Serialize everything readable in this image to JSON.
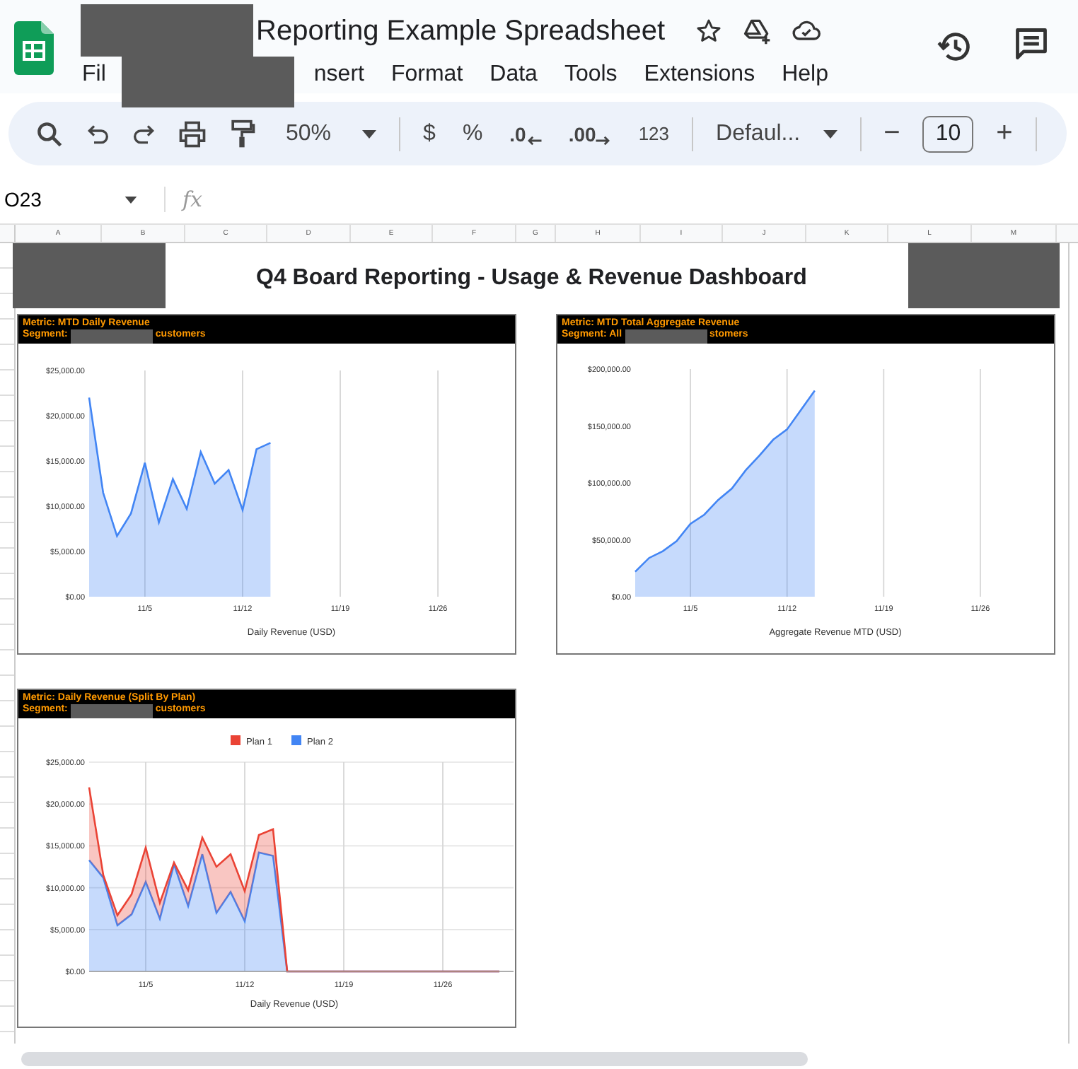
{
  "document": {
    "title": "Reporting Example Spreadsheet"
  },
  "menu": [
    "Fil",
    "nsert",
    "Format",
    "Data",
    "Tools",
    "Extensions",
    "Help"
  ],
  "toolbar": {
    "zoom": "50%",
    "currency": "$",
    "percent": "%",
    "decrease_decimal": ".0",
    "increase_decimal": ".00",
    "number_format": "123",
    "font": "Defaul...",
    "font_size_minus": "−",
    "font_size": "10",
    "font_size_plus": "+"
  },
  "formula_bar": {
    "cell_ref": "O23",
    "fx": "fx"
  },
  "columns": [
    "A",
    "B",
    "C",
    "D",
    "E",
    "F",
    "G",
    "H",
    "I",
    "J",
    "K",
    "L",
    "M"
  ],
  "dashboard": {
    "title": "Q4 Board Reporting - Usage & Revenue Dashboard",
    "charts": [
      {
        "metric": "Metric: MTD Daily Revenue",
        "segment_start": "Segment:",
        "segment_end": "customers",
        "chart_data": {
          "type": "area",
          "grid": "x",
          "xlabel": "Daily Revenue (USD)",
          "categories": [
            null,
            null,
            null,
            null,
            "11/5",
            null,
            null,
            null,
            null,
            null,
            null,
            "11/12",
            null,
            null,
            null,
            null,
            null,
            null,
            "11/19",
            null,
            null,
            null,
            null,
            null,
            null,
            "11/26",
            null,
            null,
            null,
            null
          ],
          "ylim": [
            0,
            25000
          ],
          "yticks": [
            {
              "value": 0,
              "label": "$0.00"
            },
            {
              "value": 5000,
              "label": "$5,000.00"
            },
            {
              "value": 10000,
              "label": "$10,000.00"
            },
            {
              "value": 15000,
              "label": "$15,000.00"
            },
            {
              "value": 20000,
              "label": "$20,000.00"
            },
            {
              "value": 25000,
              "label": "$25,000.00"
            }
          ],
          "series": [
            {
              "color": "#4285f4",
              "values": [
                22000,
                11500,
                6700,
                9200,
                14800,
                8200,
                13000,
                9700,
                16000,
                12500,
                14000,
                9600,
                16300,
                17000,
                null,
                null,
                null,
                null,
                null,
                null,
                null,
                null,
                null,
                null,
                null,
                null,
                null,
                null,
                null,
                null
              ]
            }
          ]
        }
      },
      {
        "metric": "Metric: MTD Total Aggregate Revenue",
        "segment_start": "Segment: All",
        "segment_end": "stomers",
        "chart_data": {
          "type": "area",
          "grid": "x",
          "xlabel": "Aggregate Revenue MTD (USD)",
          "categories": [
            null,
            null,
            null,
            null,
            "11/5",
            null,
            null,
            null,
            null,
            null,
            null,
            "11/12",
            null,
            null,
            null,
            null,
            null,
            null,
            "11/19",
            null,
            null,
            null,
            null,
            null,
            null,
            "11/26",
            null,
            null,
            null,
            null
          ],
          "ylim": [
            0,
            200000
          ],
          "yticks": [
            {
              "value": 0,
              "label": "$0.00"
            },
            {
              "value": 50000,
              "label": "$50,000.00"
            },
            {
              "value": 100000,
              "label": "$100,000.00"
            },
            {
              "value": 150000,
              "label": "$150,000.00"
            },
            {
              "value": 200000,
              "label": "$200,000.00"
            }
          ],
          "series": [
            {
              "color": "#4285f4",
              "values": [
                22000,
                34000,
                40000,
                49000,
                64000,
                72000,
                85000,
                95000,
                111000,
                124000,
                138000,
                147000,
                164000,
                181000,
                null,
                null,
                null,
                null,
                null,
                null,
                null,
                null,
                null,
                null,
                null,
                null,
                null,
                null,
                null,
                null
              ]
            }
          ]
        }
      },
      {
        "metric": "Metric: Daily Revenue (Split By Plan)",
        "segment_start": "Segment:",
        "segment_end": "customers",
        "chart_data": {
          "type": "area",
          "stacked": true,
          "grid": "both",
          "legend": "top",
          "xlabel": "Daily Revenue (USD)",
          "categories": [
            null,
            null,
            null,
            null,
            "11/5",
            null,
            null,
            null,
            null,
            null,
            null,
            "11/12",
            null,
            null,
            null,
            null,
            null,
            null,
            "11/19",
            null,
            null,
            null,
            null,
            null,
            null,
            "11/26",
            null,
            null,
            null,
            null
          ],
          "ylim": [
            0,
            25000
          ],
          "yticks": [
            {
              "value": 0,
              "label": "$0.00"
            },
            {
              "value": 5000,
              "label": "$5,000.00"
            },
            {
              "value": 10000,
              "label": "$10,000.00"
            },
            {
              "value": 15000,
              "label": "$15,000.00"
            },
            {
              "value": 20000,
              "label": "$20,000.00"
            },
            {
              "value": 25000,
              "label": "$25,000.00"
            }
          ],
          "series": [
            {
              "name": "Plan 1",
              "color": "#ea4335",
              "values": [
                8700,
                300,
                1200,
                2400,
                4100,
                1900,
                200,
                1900,
                2000,
                5500,
                4500,
                3600,
                2100,
                3200,
                0,
                0,
                0,
                0,
                0,
                0,
                0,
                0,
                0,
                0,
                0,
                0,
                0,
                0,
                0,
                0
              ]
            },
            {
              "name": "Plan 2",
              "color": "#4285f4",
              "values": [
                13300,
                11200,
                5500,
                6800,
                10700,
                6300,
                12800,
                7800,
                14000,
                7000,
                9500,
                6000,
                14200,
                13800,
                0,
                0,
                0,
                0,
                0,
                0,
                0,
                0,
                0,
                0,
                0,
                0,
                0,
                0,
                0,
                0
              ]
            }
          ]
        }
      }
    ]
  }
}
